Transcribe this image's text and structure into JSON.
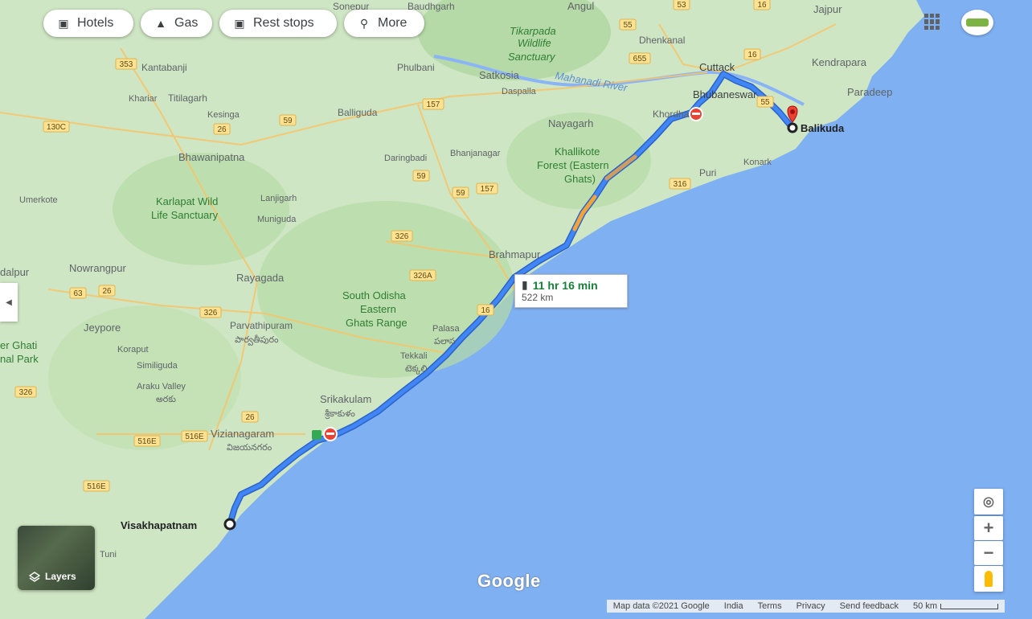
{
  "chips": {
    "hotels": "Hotels",
    "gas": "Gas",
    "rest_stops": "Rest stops",
    "more": "More"
  },
  "route": {
    "duration": "11 hr 16 min",
    "distance": "522 km",
    "origin": "Visakhapatnam",
    "destination": "Balikuda"
  },
  "places": {
    "sonepur": "Sonepur",
    "baudhgarh": "Baudhgarh",
    "angul": "Angul",
    "jajpur": "Jajpur",
    "tikarpada": "Tikarpada",
    "wildlife": "Wildlife",
    "sanctuary": "Sanctuary",
    "dhenkanal": "Dhenkanal",
    "kantabanji": "Kantabanji",
    "phulbani": "Phulbani",
    "cuttack": "Cuttack",
    "kendrapara": "Kendrapara",
    "satkosia": "Satkosia",
    "mahanadi": "Mahanadi River",
    "dasapalla": "Daspalla",
    "khariar": "Khariar",
    "titilagarh": "Titilagarh",
    "bhubaneswar": "Bhubaneswar",
    "paradeep": "Paradeep",
    "kesinga": "Kesinga",
    "balliguda": "Balliguda",
    "khordha": "Khordha",
    "nayagarh": "Nayagarh",
    "bhawanipatna": "Bhawanipatna",
    "daringbadi": "Daringbadi",
    "bhanjanagar": "Bhanjanagar",
    "khallikote1": "Khallikote",
    "khallikote2": "Forest (Eastern",
    "khallikote3": "Ghats)",
    "puri": "Puri",
    "konark": "Konark",
    "umerkote": "Umerkote",
    "karlapat1": "Karlapat Wild",
    "karlapat2": "Life Sanctuary",
    "lanjigarh": "Lanjigarh",
    "muniguda": "Muniguda",
    "brahmapur": "Brahmapur",
    "nowrangpur": "Nowrangpur",
    "dalpur": "dalpur",
    "rayagada": "Rayagada",
    "southodisha1": "South Odisha",
    "southodisha2": "Eastern",
    "southodisha3": "Ghats Range",
    "jeypore": "Jeypore",
    "parvathipuram": "Parvathipuram",
    "parvathipuram_te": "పార్వతీపురం",
    "palasa": "Palasa",
    "palasa_te": "పలాస",
    "koraput": "Koraput",
    "tekkali": "Tekkali",
    "tekkali_te": "టెక్కలి",
    "ghati1": "er Ghati",
    "ghati2": "nal Park",
    "simliguda": "Similiguda",
    "araku1": "Araku Valley",
    "araku_te": "అరకు",
    "srikakulam": "Srikakulam",
    "srikakulam_te": "శ్రీకాకుళం",
    "vizianagaram": "Vizianagaram",
    "vizianagaram_te": "విజయనగరం",
    "tuni": "Tuni"
  },
  "shields": [
    "353",
    "26",
    "59",
    "130C",
    "157",
    "55",
    "655",
    "16",
    "53",
    "55",
    "59",
    "157",
    "59",
    "326",
    "326A",
    "63",
    "26",
    "326",
    "16",
    "16",
    "26",
    "516E",
    "516E",
    "516E",
    "326",
    "316"
  ],
  "controls": {
    "zoom_in": "+",
    "zoom_out": "−"
  },
  "layers_label": "Layers",
  "footer": {
    "map_data": "Map data ©2021 Google",
    "india": "India",
    "terms": "Terms",
    "privacy": "Privacy",
    "feedback": "Send feedback",
    "scale": "50 km"
  },
  "logo": "Google",
  "colors": {
    "sea": "#7fb0f2",
    "land": "#cfe6c4",
    "route": "#4285f4",
    "route_dark": "#2a64c9",
    "traffic": "#f2a33a",
    "marker": "#ea4335",
    "duration_green": "#188038"
  }
}
